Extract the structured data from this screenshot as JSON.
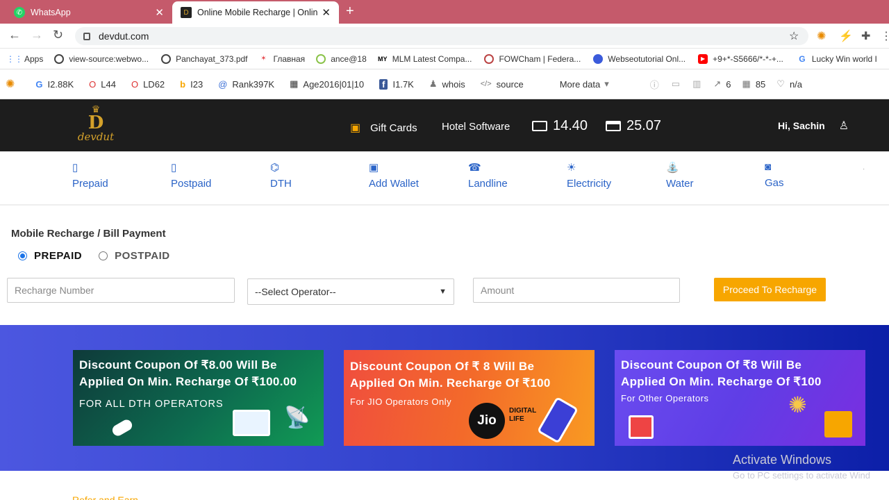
{
  "browser": {
    "tabs": [
      {
        "title": "WhatsApp",
        "icon": "whatsapp-icon"
      },
      {
        "title": "Online Mobile Recharge | Online",
        "icon": "devdut-favicon"
      }
    ],
    "url": "devdut.com"
  },
  "bookmarks": [
    {
      "label": "Apps",
      "icon": "apps-grid-icon"
    },
    {
      "label": "view-source:webwo...",
      "icon": "globe-icon"
    },
    {
      "label": "Panchayat_373.pdf",
      "icon": "globe-icon"
    },
    {
      "label": "Главная",
      "icon": "star-burst-icon"
    },
    {
      "label": "ance@18",
      "icon": "ring-icon"
    },
    {
      "label": "MLM Latest Compa...",
      "icon": "my-icon"
    },
    {
      "label": "FOWCham | Federa...",
      "icon": "fow-icon"
    },
    {
      "label": "Webseotutorial Onl...",
      "icon": "web-icon"
    },
    {
      "label": "+9+*-S5666/*-*-+...",
      "icon": "youtube-icon"
    },
    {
      "label": "Lucky Win world I",
      "icon": "google-icon"
    }
  ],
  "seo_bar": [
    {
      "label": "I2.88K",
      "icon": "G"
    },
    {
      "label": "L44",
      "icon": "O"
    },
    {
      "label": "LD62",
      "icon": "O"
    },
    {
      "label": "I23",
      "icon": "b"
    },
    {
      "label": "Rank397K",
      "icon": "@"
    },
    {
      "label": "Age2016|01|10",
      "icon": "▦"
    },
    {
      "label": "I1.7K",
      "icon": "f"
    },
    {
      "label": "whois",
      "icon": "♟"
    },
    {
      "label": "source",
      "icon": "</>"
    },
    {
      "label": "More data",
      "icon": "▾"
    }
  ],
  "seo_right": [
    {
      "label": "6"
    },
    {
      "label": "85"
    },
    {
      "label": "n/a"
    }
  ],
  "header": {
    "logo_text": "devdut",
    "logo_letter": "D",
    "gift_cards": "Gift Cards",
    "hotel_software": "Hotel Software",
    "balance1": "14.40",
    "balance2": "25.07",
    "greeting": "Hi, Sachin"
  },
  "services": [
    {
      "label": "Prepaid"
    },
    {
      "label": "Postpaid"
    },
    {
      "label": "DTH"
    },
    {
      "label": "Add Wallet"
    },
    {
      "label": "Landline"
    },
    {
      "label": "Electricity"
    },
    {
      "label": "Water"
    },
    {
      "label": "Gas"
    }
  ],
  "form": {
    "title": "Mobile Recharge / Bill Payment",
    "prepaid": "PREPAID",
    "postpaid": "POSTPAID",
    "number_placeholder": "Recharge Number",
    "operator_default": "--Select Operator--",
    "amount_placeholder": "Amount",
    "proceed": "Proceed To Recharge"
  },
  "banners": [
    {
      "heading1": "Discount Coupon Of ₹8.00 Will Be",
      "heading2": "Applied On Min. Recharge Of ₹100.00",
      "sub": "FOR ALL DTH OPERATORS"
    },
    {
      "heading1": "Discount Coupon Of ₹ 8  Will Be",
      "heading2": "Applied On Min. Recharge Of ₹100",
      "sub": "For JIO Operators Only",
      "jio": "Jio",
      "jio_tag1": "DIGITAL",
      "jio_tag2": "LIFE"
    },
    {
      "heading1": "Discount Coupon Of ₹8 Will Be",
      "heading2": "Applied On Min. Recharge Of ₹100",
      "sub": "For Other Operators"
    }
  ],
  "watermark": {
    "title": "Activate Windows",
    "sub": "Go to PC settings to activate Wind"
  },
  "refer": "Refer and Earn"
}
